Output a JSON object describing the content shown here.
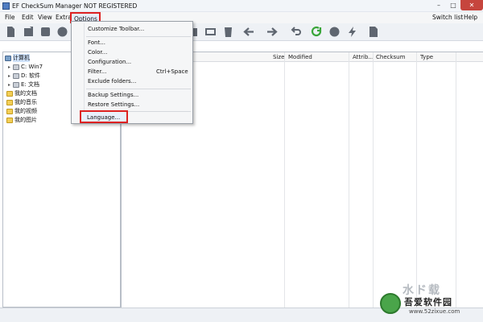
{
  "window": {
    "title": "EF CheckSum Manager NOT REGISTERED",
    "controls": {
      "minimize": "–",
      "maximize": "□",
      "close": "✕"
    }
  },
  "menubar": {
    "file": "File",
    "edit": "Edit",
    "view": "View",
    "extra": "Extra",
    "options": "Options",
    "switch_list": "Switch list",
    "help": "Help"
  },
  "toolbar_icons": [
    "new-icon",
    "open-icon",
    "save-icon",
    "record-icon",
    "folder-add-icon",
    "export-icon",
    "delete-icon",
    "back-arrow-icon",
    "forward-arrow-icon",
    "undo-icon",
    "refresh-icon",
    "stop-icon",
    "lightning-icon",
    "document-icon"
  ],
  "options_menu": {
    "customize_toolbar": "Customize Toolbar...",
    "font": "Font...",
    "color": "Color...",
    "configuration": "Configuration...",
    "filter": "Filter...",
    "filter_shortcut": "Ctrl+Space",
    "exclude_folders": "Exclude folders...",
    "backup_settings": "Backup Settings...",
    "restore_settings": "Restore Settings...",
    "language": "Language..."
  },
  "tree": {
    "root": "计算机",
    "drive_c": "C: Win7",
    "drive_d": "D: 软件",
    "drive_e": "E: 文档",
    "documents": "我的文档",
    "music": "我的音乐",
    "videos": "我的视频",
    "pictures": "我的图片"
  },
  "file_columns": {
    "size": "Size",
    "modified": "Modified",
    "attributes": "Attrib...",
    "checksum": "Checksum",
    "type": "Type"
  },
  "watermark": {
    "big_text": "水ド载",
    "site_name": "吾爱软件园",
    "url": "www.52zixue.com"
  },
  "colors": {
    "highlight_red": "#dd2222",
    "menu_bg": "#f5f6f7",
    "close_button": "#c6453d"
  }
}
